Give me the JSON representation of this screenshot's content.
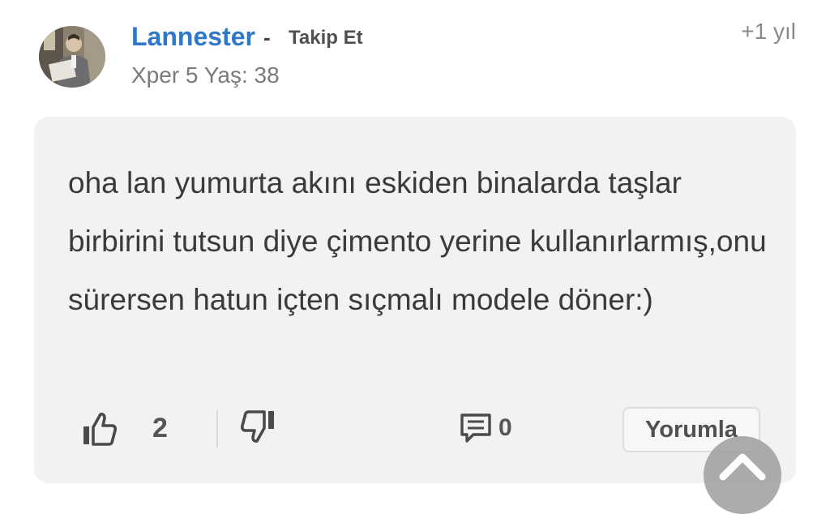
{
  "author": {
    "username": "Lannester",
    "dash": "-",
    "follow_label": "Takip Et",
    "meta": "Xper 5 Yaş: 38",
    "avatar_icon": "user-photo-avatar"
  },
  "timestamp": "+1 yıl",
  "comment": {
    "text": "oha lan yumurta akını eskiden binalarda taşlar birbirini tutsun diye çimento yerine kullanırlarmış,onu sürersen hatun içten sıçmalı modele döner:)"
  },
  "actions": {
    "like_icon": "thumbs-up-icon",
    "like_count": "2",
    "dislike_icon": "thumbs-down-icon",
    "reply_icon": "comment-icon",
    "reply_count": "0",
    "reply_button_label": "Yorumla"
  },
  "scroll_top_icon": "chevron-up-icon",
  "colors": {
    "username": "#2f78c9",
    "card_background": "#f2f2f2",
    "muted_text": "#7a7a7a",
    "scroll_button": "#9e9e9e"
  }
}
